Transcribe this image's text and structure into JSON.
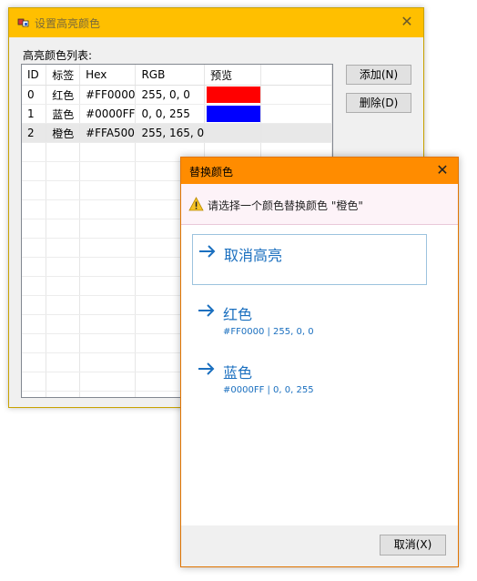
{
  "main_window": {
    "title": "设置高亮颜色",
    "list_caption": "高亮颜色列表:",
    "columns": [
      "ID",
      "标签",
      "Hex",
      "RGB",
      "预览"
    ],
    "rows": [
      {
        "id": "0",
        "label": "红色",
        "hex": "#FF0000",
        "rgb": "255, 0, 0",
        "color": "#ff0000"
      },
      {
        "id": "1",
        "label": "蓝色",
        "hex": "#0000FF",
        "rgb": "0, 0, 255",
        "color": "#0000ff"
      },
      {
        "id": "2",
        "label": "橙色",
        "hex": "#FFA500",
        "rgb": "255, 165, 0",
        "color": null
      }
    ],
    "add_button": "添加(N)",
    "delete_button": "删除(D)"
  },
  "dialog": {
    "title": "替换颜色",
    "prompt": "请选择一个颜色替换颜色 \"橙色\"",
    "options": [
      {
        "label": "取消高亮",
        "detail": ""
      },
      {
        "label": "红色",
        "detail": "#FF0000 | 255, 0, 0"
      },
      {
        "label": "蓝色",
        "detail": "#0000FF | 0, 0, 255"
      }
    ],
    "cancel_button": "取消(X)"
  },
  "colors": {
    "main_titlebar": "#ffbf00",
    "dialog_titlebar": "#ff8c00",
    "link_blue": "#1a6fbf"
  }
}
